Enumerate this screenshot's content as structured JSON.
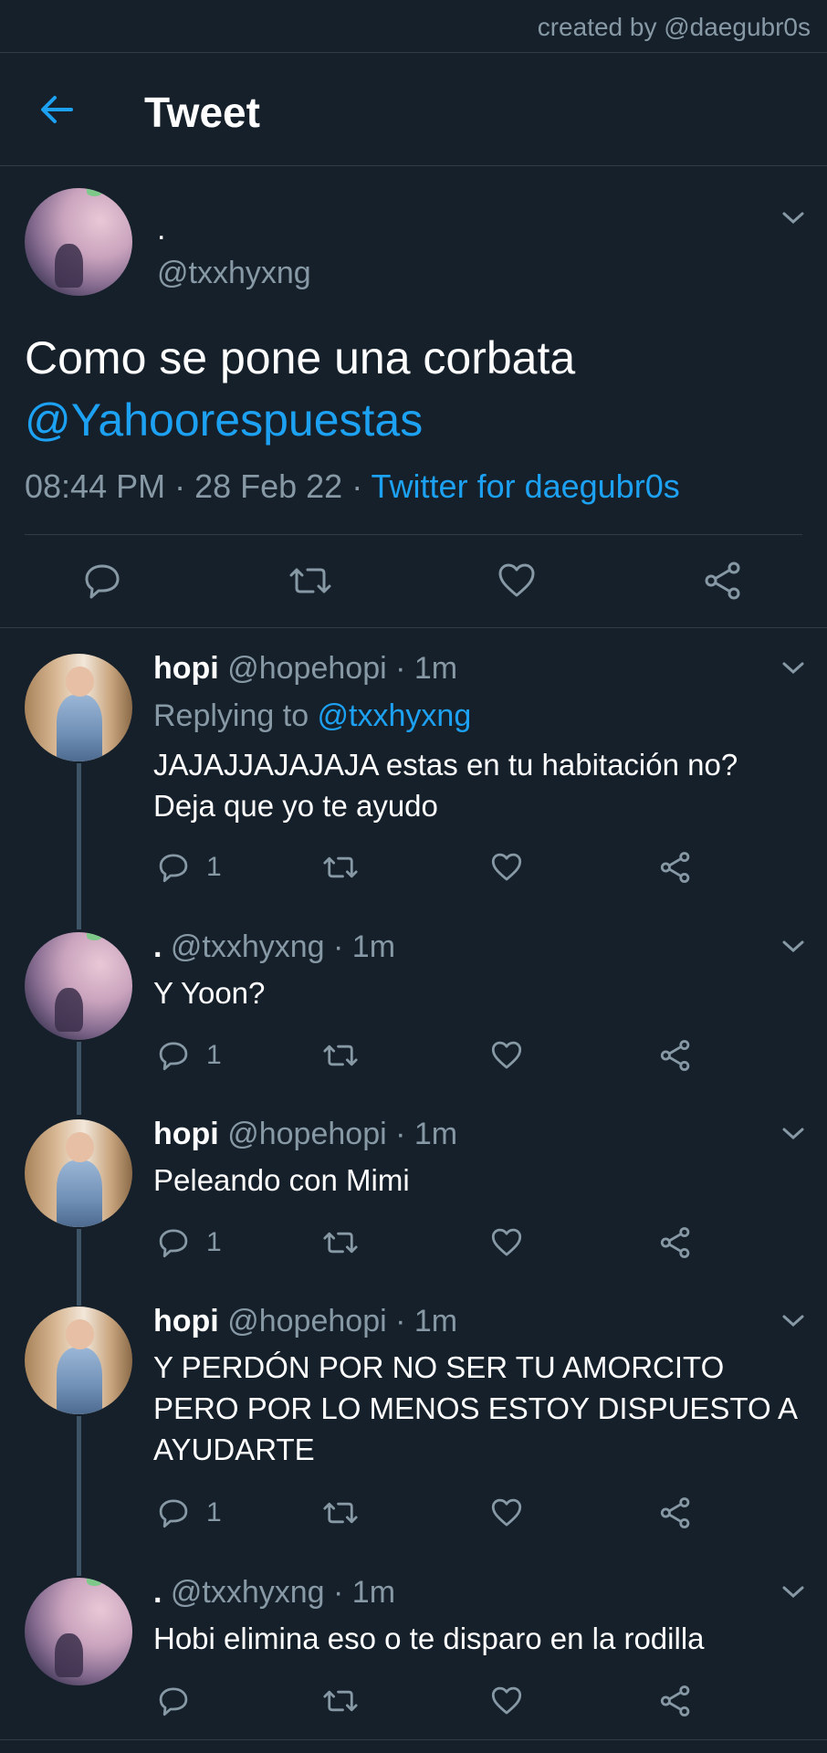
{
  "credit": "created by @daegubr0s",
  "header": {
    "title": "Tweet",
    "back_icon": "arrow-left-icon",
    "accent": "#1da1f2"
  },
  "main": {
    "name": ".",
    "handle": "@txxhyxng",
    "text": "Como se pone una corbata",
    "mention": "@Yahoorespuestas",
    "time": "08:44 PM · 28 Feb 22 · ",
    "source": "Twitter for daegubr0s"
  },
  "replies": [
    {
      "name": "hopi",
      "handle": "@hopehopi · 1m",
      "replying_label": "Replying to ",
      "replying_handle": "@txxhyxng",
      "line1": "JAJAJJAJAJAJA estas en tu habitación no?",
      "line2": "Deja que yo te ayudo",
      "count": "1"
    },
    {
      "name": ".",
      "handle": "@txxhyxng · 1m",
      "line1": "Y Yoon?",
      "count": "1"
    },
    {
      "name": "hopi",
      "handle": "@hopehopi · 1m",
      "line1": "Peleando con Mimi",
      "count": "1"
    },
    {
      "name": "hopi",
      "handle": "@hopehopi · 1m",
      "line1": "Y PERDÓN POR NO SER TU AMORCITO",
      "line2": "PERO POR LO MENOS ESTOY DISPUESTO A",
      "line3": "AYUDARTE",
      "count": "1"
    },
    {
      "name": ".",
      "handle": "@txxhyxng · 1m",
      "line1": "Hobi elimina eso o te disparo en la rodilla"
    }
  ]
}
